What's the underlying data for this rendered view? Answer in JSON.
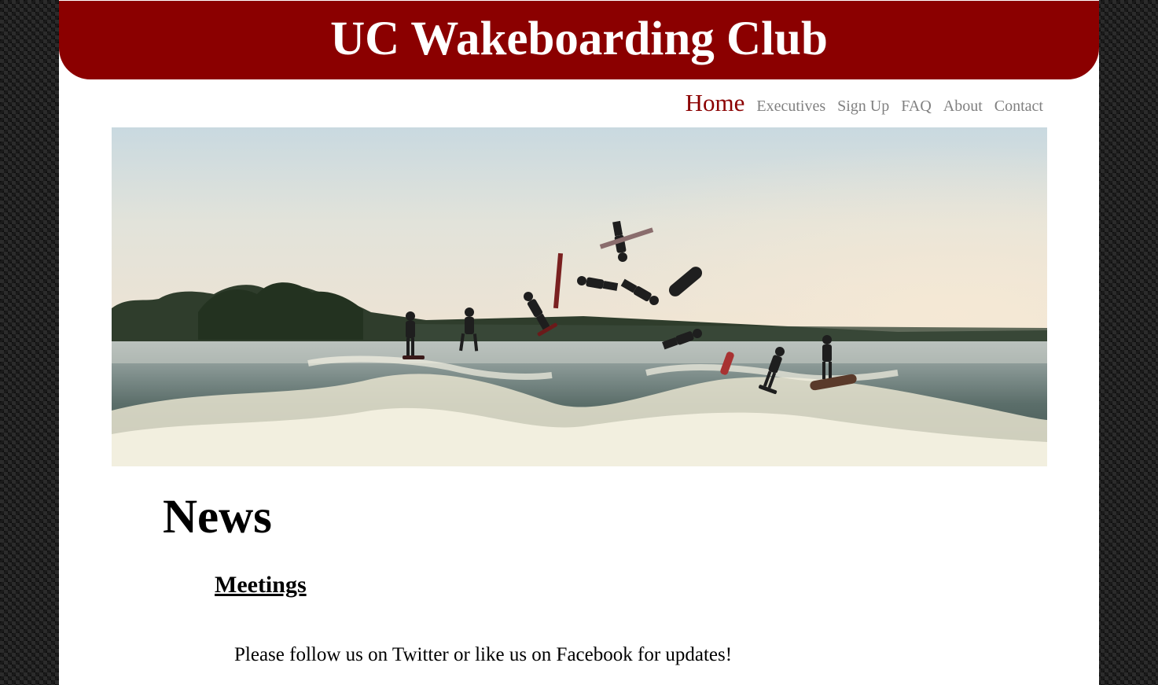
{
  "site": {
    "title": "UC Wakeboarding Club"
  },
  "nav": {
    "items": [
      {
        "label": "Home",
        "active": true
      },
      {
        "label": "Executives",
        "active": false
      },
      {
        "label": "Sign Up",
        "active": false
      },
      {
        "label": "FAQ",
        "active": false
      },
      {
        "label": "About",
        "active": false
      },
      {
        "label": "Contact",
        "active": false
      }
    ]
  },
  "hero": {
    "description_icon": "wakeboard-sequence-photo"
  },
  "news": {
    "heading": "News",
    "section_title": "Meetings",
    "paragraph": "Please follow us on Twitter or like us on Facebook for updates!"
  },
  "colors": {
    "brand": "#8b0000",
    "nav_inactive": "#808080",
    "page_bg": "#ffffff"
  }
}
